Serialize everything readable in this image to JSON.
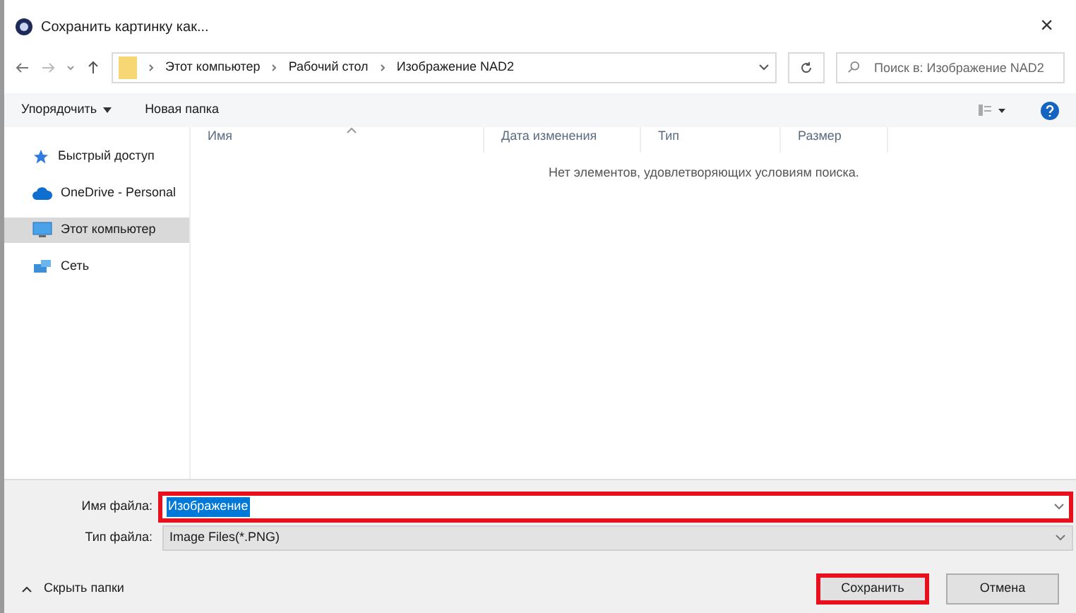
{
  "window": {
    "title": "Сохранить картинку как...",
    "close": "×"
  },
  "breadcrumb": [
    "Этот компьютер",
    "Рабочий стол",
    "Изображение NAD2"
  ],
  "search": {
    "placeholder": "Поиск в: Изображение NAD2"
  },
  "toolbar": {
    "organize": "Упорядочить",
    "new_folder": "Новая папка"
  },
  "sidebar": {
    "items": [
      {
        "label": "Быстрый доступ",
        "kind": "star",
        "selected": false
      },
      {
        "label": "OneDrive - Personal",
        "kind": "cloud",
        "selected": false
      },
      {
        "label": "Этот компьютер",
        "kind": "computer",
        "selected": true
      },
      {
        "label": "Сеть",
        "kind": "network",
        "selected": false
      }
    ]
  },
  "table": {
    "columns": [
      "Имя",
      "Дата изменения",
      "Тип",
      "Размер"
    ],
    "empty_message": "Нет элементов, удовлетворяющих условиям поиска."
  },
  "filename": {
    "label": "Имя файла:",
    "value": "Изображение",
    "highlighted": true
  },
  "filetype": {
    "label": "Тип файла:",
    "value": "Image Files(*.PNG)"
  },
  "hide_folders": "Скрыть папки",
  "buttons": [
    {
      "label": "Сохранить",
      "highlighted": true
    },
    {
      "label": "Отмена",
      "highlighted": false
    }
  ]
}
